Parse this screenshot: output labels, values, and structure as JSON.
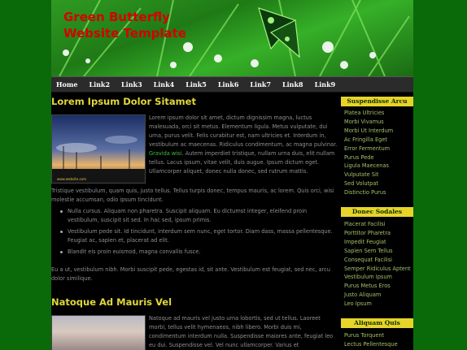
{
  "header": {
    "title": "Green Butterfly\nWebsite Template"
  },
  "nav": [
    "Home",
    "Link2",
    "Link3",
    "Link4",
    "Link5",
    "Link6",
    "Link7",
    "Link8",
    "Link9"
  ],
  "post1": {
    "title": "Lorem Ipsum Dolor Sitamet",
    "image_caption": "www.website.com",
    "intro_before_link": "Lorem ipsum dolor sit amet, dictum dignissim magna, luctus malesuada, orci sit metus. Elementum ligula. Metus vulputate, dui urna, purus velit. Felis curabitur est, nam ultricies et. Interdum in, vestibulum ac maecenas. Ridiculus condimentum, ac magna pulvinar.",
    "intro_link": "Gravida wisi",
    "intro_after_link": ". Autem imperdiet tristique, nullam urna duis, elit nullam tellus. Lacus ipsum, vitae velit, duis augue. Ipsum dictum eget. Ullamcorper aliquet, donec nulla donec, sed rutrum mattis.",
    "para2": "Tristique vestibulum, quam quis, justo tellus. Tellus turpis donec, tempus mauris, ac lorem. Quis orci, wisi molestie accumsan, odio ipsum tincidunt.",
    "bullets": [
      "Nulla cursus. Aliquam non pharetra. Suscipit aliquam. Eu dictumst integer, eleifend proin vestibulum, suscipit sit sed. In hac sed, ipsum primis.",
      "Vestibulum pede sit. Id tincidunt, interdum sem nunc, eget tortor. Diam dass, massa pellentesque. Feugiat ac, sapien et, placerat ad elit.",
      "Blandit eis proin euismod, magna convallis fusce."
    ],
    "para3": "Eu a ut, vestibulum nibh. Morbi suscipit pede, egestas id, sit ante. Vestibulum est feugiat, sed nec, arcu dolor similique."
  },
  "post2": {
    "title": "Natoque Ad Mauris Vel",
    "intro": "Natoque ad mauris vel justo urna lobortis, sed ut tellus. Laoreet morbi, tellus velit hymenaeos, nibh libero. Morbi duis mi, condimentum interdum nulla. Suspendisse maiores ante, feugiat leo eu dui. Suspendisse vel. Vel nunc ullamcorper. Varius et"
  },
  "sidebar": {
    "sections": [
      {
        "title": "Suspendisse Arcu",
        "items": [
          "Platea Ultricies",
          "Morbi Vivamus",
          "Morbi Ut Interdum",
          "Ac Fringilla Eget",
          "Error Fermentum",
          "Purus Pede",
          "Ligula Maecenas",
          "Vulputate Sit",
          "Sed Volutpat",
          "Distinctio Purus"
        ]
      },
      {
        "title": "Donec Sodales",
        "items": [
          "Placerat Facilisi",
          "Porttitor Pharetra",
          "Impedit Feugiat",
          "Sapien Sem Tellus",
          "Consequat Facilisi",
          "Semper Ridiculus Aptent",
          "Vestibulum Ipsum",
          "Purus Metus Eros",
          "Justo Aliquam",
          "Leo Ipsum"
        ]
      },
      {
        "title": "Aliquam Quis",
        "items": [
          "Purus Torquent",
          "Lectus Pellentesque"
        ]
      }
    ]
  }
}
